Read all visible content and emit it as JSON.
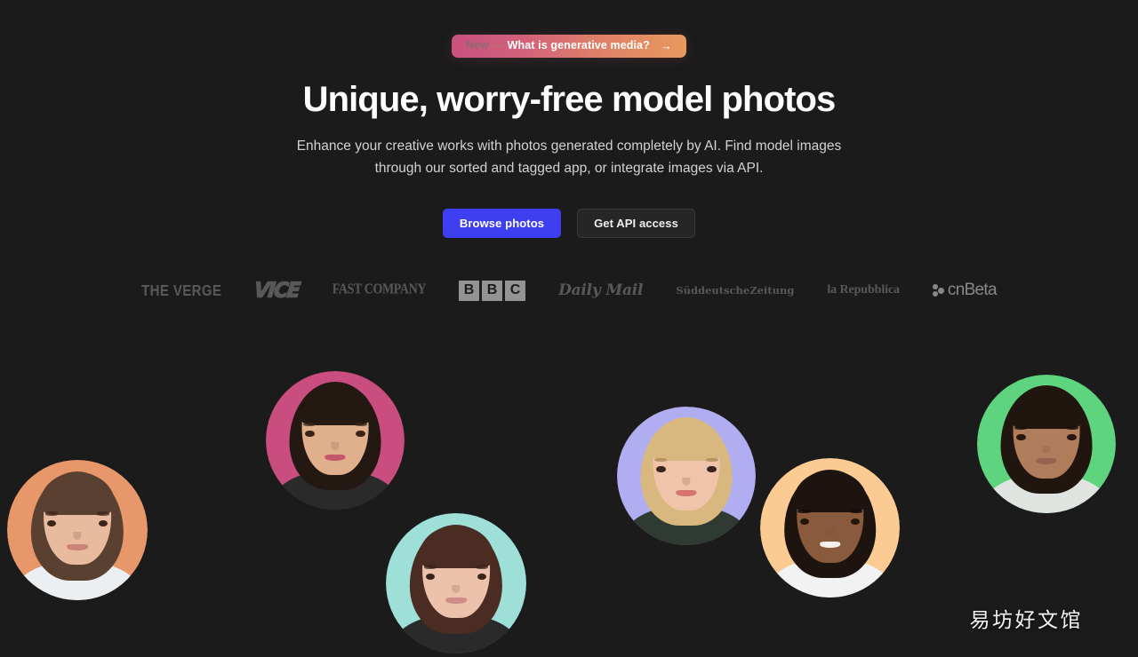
{
  "page": {
    "background_color": "#1b1b1b",
    "watermark": "易坊好文馆"
  },
  "hero": {
    "badge": {
      "new_label": "New",
      "dash": "—",
      "text": "What is generative media?",
      "arrow": "→",
      "gradient_from": "#c8517f",
      "gradient_to": "#e89a5c"
    },
    "headline": "Unique, worry-free model photos",
    "subtitle": "Enhance your creative works with photos generated completely by AI. Find model images through our sorted and tagged app, or integrate images via API.",
    "cta": {
      "primary_label": "Browse photos",
      "primary_color": "#3f3ff2",
      "secondary_label": "Get API access",
      "secondary_color": "#262626"
    }
  },
  "press_logos": [
    {
      "name": "the-verge",
      "label": "THE VERGE"
    },
    {
      "name": "vice",
      "label": "VICE"
    },
    {
      "name": "fast-company",
      "label": "FAST COMPANY"
    },
    {
      "name": "bbc",
      "letters": [
        "B",
        "B",
        "C"
      ]
    },
    {
      "name": "daily-mail",
      "label": "Daily Mail"
    },
    {
      "name": "sueddeutsche-zeitung",
      "line1": "Süddeutsche",
      "line2": "Zeitung"
    },
    {
      "name": "la-repubblica",
      "label": "la Repubblica"
    },
    {
      "name": "cnbeta",
      "label": "cnBeta"
    }
  ],
  "avatars": [
    {
      "name": "avatar-boy-orange",
      "bg": "#e8976a",
      "skin": "#e8bb9f",
      "hair": "#5a4030",
      "lips": "#c98477",
      "shirt": "#eceff1"
    },
    {
      "name": "avatar-woman-pink",
      "bg": "#c94d7f",
      "skin": "#e0b08d",
      "hair": "#241812",
      "lips": "#c4576b",
      "shirt": "#2a2a2a"
    },
    {
      "name": "avatar-woman-teal",
      "bg": "#9ee0d8",
      "skin": "#edc2ac",
      "hair": "#4a2c22",
      "lips": "#cf8d88",
      "shirt": "#2a2a2a"
    },
    {
      "name": "avatar-girl-purple",
      "bg": "#b0aef0",
      "skin": "#f0c4ab",
      "hair": "#d8b87e",
      "lips": "#d4736f",
      "shirt": "#2f3a32"
    },
    {
      "name": "avatar-man-peach",
      "bg": "#fbcb93",
      "skin": "#8a5a3c",
      "hair": "#1d1410",
      "lips": "#6e4030",
      "shirt": "#f2f2f2"
    },
    {
      "name": "avatar-girl-green",
      "bg": "#5ed47f",
      "skin": "#b07d5c",
      "hair": "#20160f",
      "lips": "#9a6151",
      "shirt": "#dfe4e0"
    }
  ]
}
